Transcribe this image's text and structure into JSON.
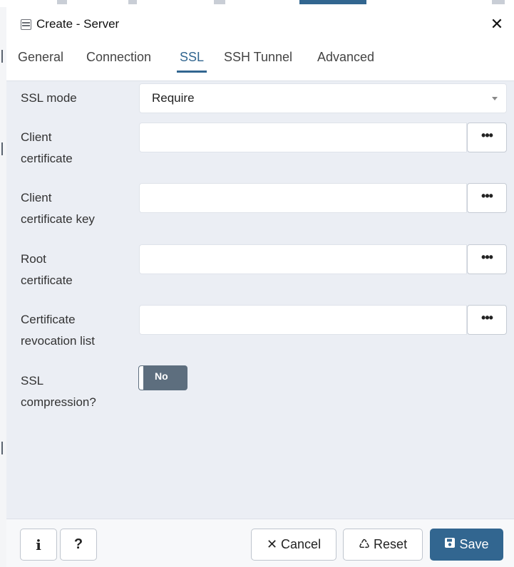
{
  "dialog": {
    "title": "Create - Server",
    "close_symbol": "✕"
  },
  "tabs": [
    {
      "label": "General",
      "active": false
    },
    {
      "label": "Connection",
      "active": false
    },
    {
      "label": "SSL",
      "active": true
    },
    {
      "label": "SSH Tunnel",
      "active": false
    },
    {
      "label": "Advanced",
      "active": false
    }
  ],
  "form": {
    "ssl_mode": {
      "label": "SSL mode",
      "value": "Require"
    },
    "client_certificate": {
      "label_line1": "Client",
      "label_line2": "certificate",
      "value": "",
      "browse": "•••"
    },
    "client_certificate_key": {
      "label_line1": "Client",
      "label_line2": "certificate key",
      "value": "",
      "browse": "•••"
    },
    "root_certificate": {
      "label_line1": "Root",
      "label_line2": "certificate",
      "value": "",
      "browse": "•••"
    },
    "crl": {
      "label_line1": "Certificate",
      "label_line2": "revocation list",
      "value": "",
      "browse": "•••"
    },
    "ssl_compression": {
      "label_line1": "SSL",
      "label_line2": "compression?",
      "value": "No"
    }
  },
  "footer": {
    "info": "i",
    "help": "?",
    "cancel": "Cancel",
    "reset": "Reset",
    "save": "Save"
  },
  "icons": {
    "title": "server-icon",
    "close": "close-icon",
    "cancel": "x-icon",
    "reset": "recycle-icon",
    "save": "floppy-disk-icon"
  },
  "colors": {
    "accent": "#326690",
    "toggle_off": "#5d6e7e",
    "panel_bg": "#ebeef4"
  }
}
